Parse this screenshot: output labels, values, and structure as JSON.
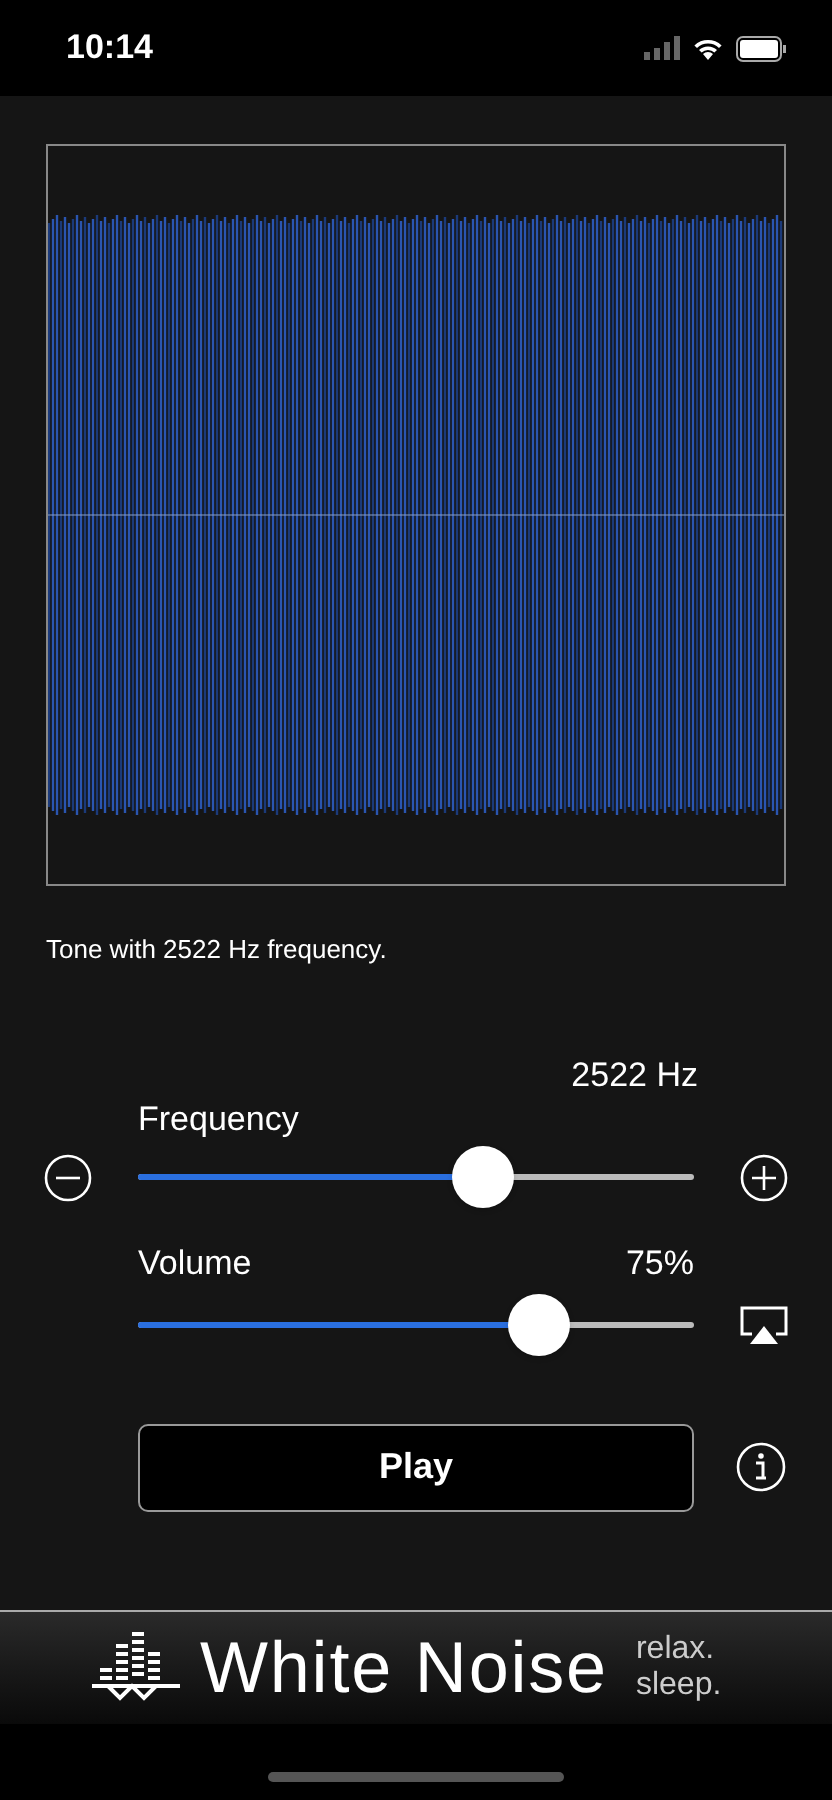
{
  "status_bar": {
    "time": "10:14"
  },
  "caption": "Tone with 2522 Hz frequency.",
  "sliders": [
    {
      "kind": "frequency",
      "label": "Frequency",
      "reading": "2522 Hz",
      "level": 0.62
    },
    {
      "kind": "volume",
      "label": "Volume",
      "reading": "75%",
      "level": 0.72
    }
  ],
  "play_button": "Play",
  "banner": {
    "title": "White Noise",
    "tagline_1": "relax.",
    "tagline_2": "sleep."
  }
}
